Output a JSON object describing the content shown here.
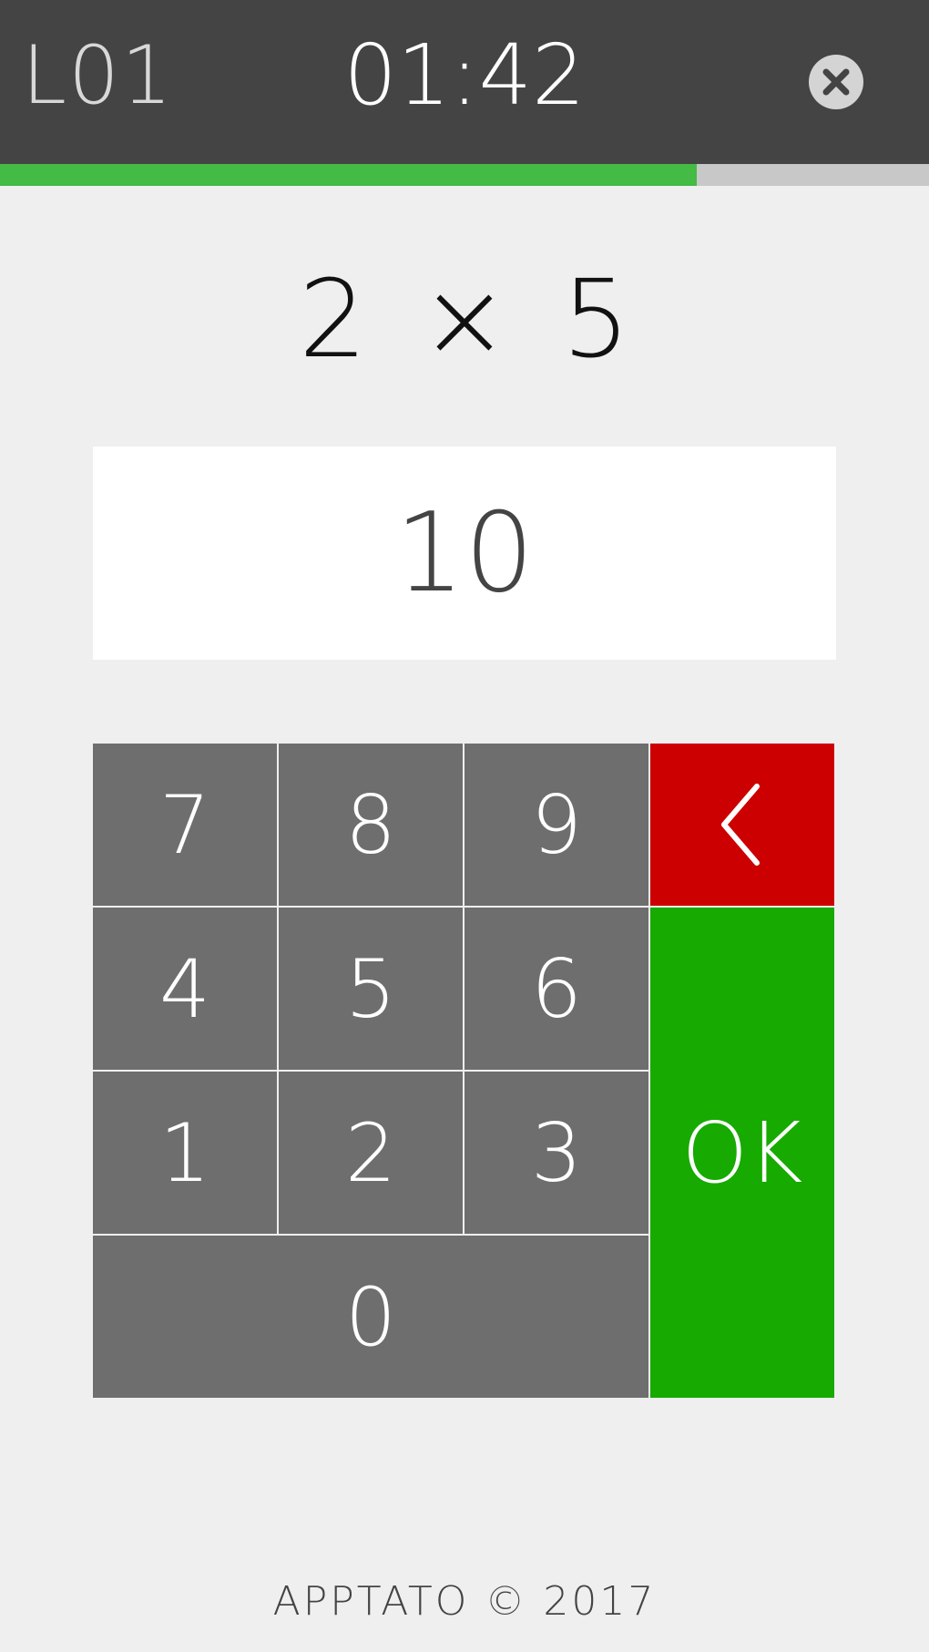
{
  "header": {
    "level": "L01",
    "timer": "01:42",
    "close_icon": "close-circle-icon"
  },
  "progress": {
    "fraction": 0.75,
    "fill_color": "#44bb44",
    "track_color": "#c8c8c8"
  },
  "question": {
    "text": "2 × 5"
  },
  "answer": {
    "value": "10"
  },
  "keypad": {
    "keys": [
      {
        "label": "7"
      },
      {
        "label": "8"
      },
      {
        "label": "9"
      },
      {
        "label": "4"
      },
      {
        "label": "5"
      },
      {
        "label": "6"
      },
      {
        "label": "1"
      },
      {
        "label": "2"
      },
      {
        "label": "3"
      },
      {
        "label": "0"
      }
    ],
    "backspace_icon": "chevron-left-icon",
    "backspace_color": "#cc0000",
    "ok_label": "OK",
    "ok_color": "#17aa00"
  },
  "footer": {
    "text": "APPTATO © 2017"
  }
}
